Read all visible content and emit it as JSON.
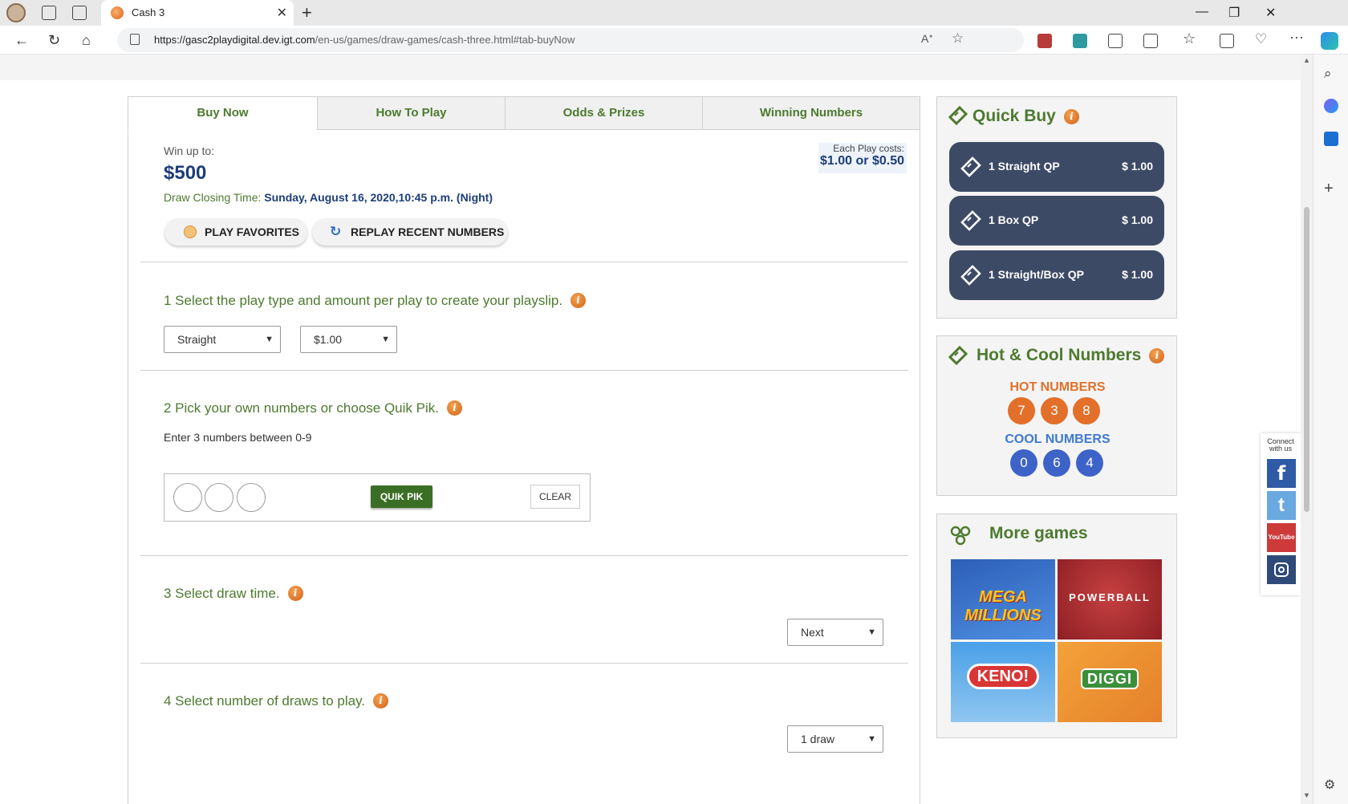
{
  "browser": {
    "tab_title": "Cash 3",
    "url_host": "https://gasc2playdigital.dev.igt.com",
    "url_path": "/en-us/games/draw-games/cash-three.html#tab-buyNow"
  },
  "tabs": [
    {
      "label": "Buy Now"
    },
    {
      "label": "How To Play"
    },
    {
      "label": "Odds & Prizes"
    },
    {
      "label": "Winning Numbers"
    }
  ],
  "buy": {
    "win_up_to_label": "Win up to:",
    "prize": "$500",
    "closing_label": "Draw Closing Time: ",
    "closing_value": "Sunday, August 16, 2020,10:45 p.m. (Night)",
    "cost_label": "Each Play costs:",
    "cost_value": "$1.00 or $0.50",
    "play_favorites": "PLAY FAVORITES",
    "replay_recent": "REPLAY RECENT NUMBERS"
  },
  "steps": {
    "step1": "1 Select the play type and amount per play to create your playslip.",
    "play_type": "Straight",
    "amount": "$1.00",
    "step2": "2 Pick your own numbers or choose Quik Pik.",
    "enter_hint": "Enter 3 numbers between 0-9",
    "quik_pik": "QUIK PIK",
    "clear": "CLEAR",
    "step3": "3 Select draw time.",
    "draw_time": "Next",
    "step4": "4 Select number of draws to play.",
    "draws": "1 draw"
  },
  "quick_buy": {
    "title": "Quick Buy",
    "items": [
      {
        "label": "1 Straight QP",
        "price": "$ 1.00"
      },
      {
        "label": "1 Box QP",
        "price": "$ 1.00"
      },
      {
        "label": "1 Straight/Box QP",
        "price": "$ 1.00"
      }
    ]
  },
  "hot_cool": {
    "title": "Hot & Cool Numbers",
    "hot_label": "HOT NUMBERS",
    "hot": [
      "7",
      "3",
      "8"
    ],
    "cool_label": "COOL NUMBERS",
    "cool": [
      "0",
      "6",
      "4"
    ]
  },
  "more_games": {
    "title": "More games",
    "games": [
      {
        "name": "MEGA MILLIONS"
      },
      {
        "name": "POWERBALL"
      },
      {
        "name": "KENO!"
      },
      {
        "name": "DIGGI"
      }
    ]
  },
  "social": {
    "connect": "Connect with us",
    "facebook": "f",
    "twitter": "t",
    "youtube": "YouTube"
  },
  "colors": {
    "brand_green": "#4d7a2f",
    "navy": "#1d3d7a",
    "quickbuy_button": "#3d4a66",
    "hot_ball": "#e2702a",
    "cool_ball": "#3d63c8"
  }
}
